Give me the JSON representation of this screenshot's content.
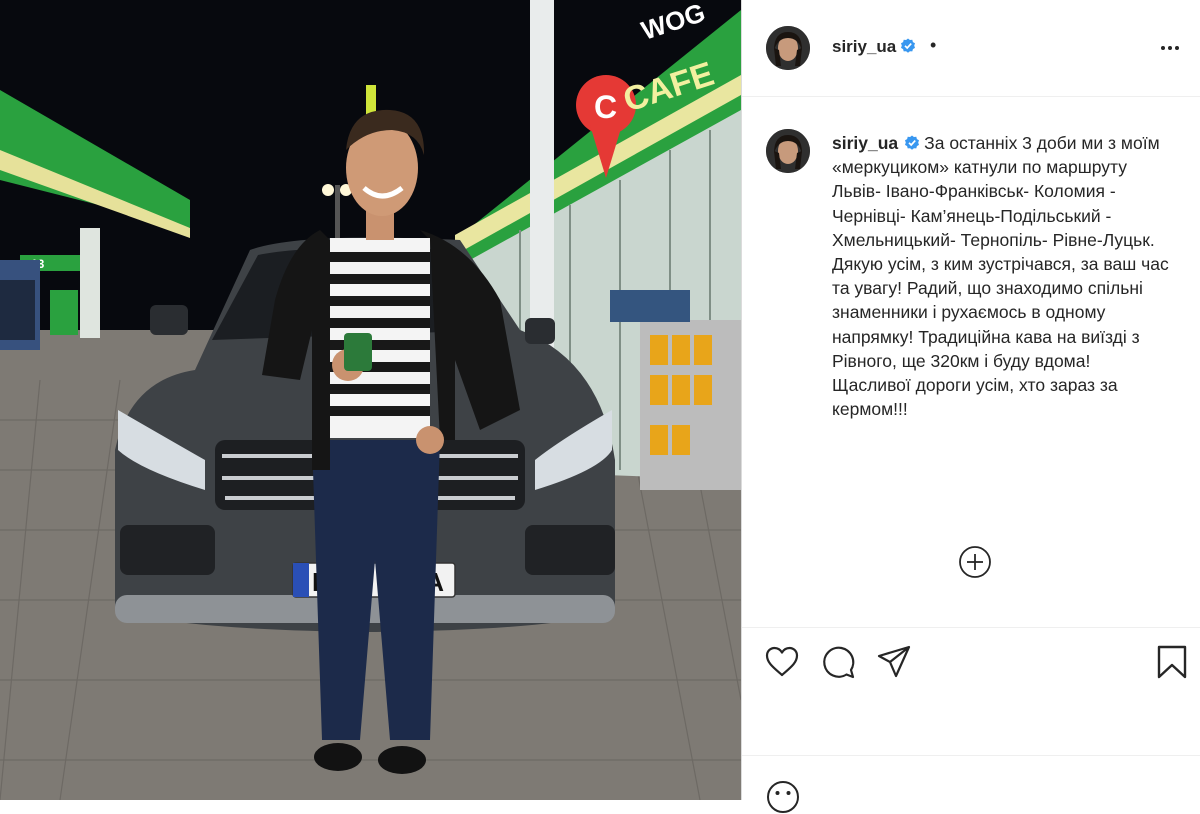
{
  "post": {
    "username": "siriy_ua",
    "verified": true,
    "separator": "•",
    "caption": "За останніх 3 доби ми з моїм «меркуциком» катнули по маршруту Львів- Івано-Франківськ- Коломия - Чернівці- Кам’янець-Подільський - Хмельницький- Тернопіль- Рівне-Луцьк.\nДякую усім, з ким зустрічався, за ваш час та увагу! Радий, що знаходимо спільні знаменники і рухаємось в одному напрямку! Традиційна кава на виїзді з Рівного, ще 320км і буду вдома!\nЩасливої дороги усім, хто зараз за кермом!!!"
  },
  "photo": {
    "sign_letter": "C",
    "sign_line1": "WOG",
    "sign_line2": "CAFE",
    "pump_number": "13",
    "plate_left": "BI",
    "plate_right": "6BA"
  },
  "icons": {
    "more": "more-horizontal-icon",
    "verified": "verified-badge-icon",
    "load_more": "plus-circle-icon",
    "like": "heart-icon",
    "comment": "comment-bubble-icon",
    "share": "paper-plane-icon",
    "save": "bookmark-icon",
    "emoji": "emoji-icon"
  },
  "colors": {
    "verified_blue": "#3897f0",
    "wog_green": "#2aa13f",
    "text": "#262626",
    "border": "#dbdbdb"
  }
}
